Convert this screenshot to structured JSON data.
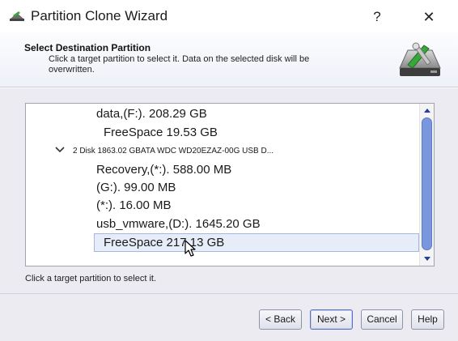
{
  "window": {
    "title": "Partition Clone Wizard",
    "help_label": "?",
    "close_label": "✕"
  },
  "header": {
    "title": "Select Destination Partition",
    "description": "Click a target partition to select it. Data on the selected disk will be overwritten."
  },
  "tree": {
    "rows": [
      {
        "label": "data,(F:).   208.29 GB"
      },
      {
        "label": "FreeSpace 19.53 GB"
      },
      {
        "label": "2 Disk 1863.02 GBATA      WDC WD20EZAZ-00G USB D..."
      },
      {
        "label": "Recovery,(*:).   588.00 MB"
      },
      {
        "label": "(G:).   99.00 MB"
      },
      {
        "label": "(*:).   16.00 MB"
      },
      {
        "label": "usb_vmware,(D:).   1645.20 GB"
      },
      {
        "label": "FreeSpace 217.13 GB",
        "selected": true
      }
    ]
  },
  "hint": "Click a target partition to select it.",
  "buttons": {
    "back": "< Back",
    "next": "Next >",
    "cancel": "Cancel",
    "help": "Help"
  },
  "icons": {
    "app": "disk-wizard-icon",
    "header": "disk-tools-icon",
    "expand": "chevron-down-icon",
    "scroll_up": "scroll-up-arrow-icon",
    "scroll_down": "scroll-down-arrow-icon",
    "cursor": "mouse-cursor-icon"
  },
  "colors": {
    "accent": "#7a97de",
    "selection": "#e6ecf8",
    "icon_green": "#38a83a"
  }
}
